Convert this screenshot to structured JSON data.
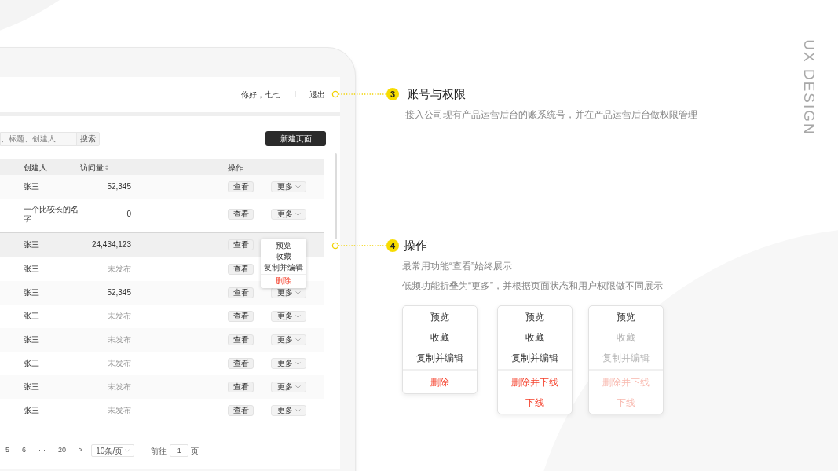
{
  "header": {
    "greeting": "你好，七七",
    "separator": "I",
    "logout": "退出"
  },
  "toolbar": {
    "search_placeholder": "、标题、创建人",
    "search_button": "搜索",
    "new_button": "新建页面"
  },
  "table": {
    "columns": [
      "创建人",
      "访问量",
      "操作"
    ],
    "rows": [
      {
        "creator": "张三",
        "visits": "52,345",
        "kind": "number",
        "view": "查看",
        "more": "更多",
        "selected": false
      },
      {
        "creator": "一个比较长的名字",
        "visits": "0",
        "kind": "number",
        "view": "查看",
        "more": "更多",
        "selected": false
      },
      {
        "creator": "张三",
        "visits": "24,434,123",
        "kind": "number",
        "view": "查看",
        "selected": true,
        "menu": [
          {
            "label": "预览",
            "kind": "normal"
          },
          {
            "label": "收藏",
            "kind": "normal"
          },
          {
            "label": "复制并编辑",
            "kind": "normal"
          },
          {
            "label": "删除",
            "kind": "danger"
          }
        ]
      },
      {
        "creator": "张三",
        "visits": "未发布",
        "kind": "status",
        "view": "查看",
        "selected": false
      },
      {
        "creator": "张三",
        "visits": "52,345",
        "kind": "number",
        "view": "查看",
        "more": "更多",
        "selected": false
      },
      {
        "creator": "张三",
        "visits": "未发布",
        "kind": "status",
        "view": "查看",
        "more": "更多",
        "selected": false
      },
      {
        "creator": "张三",
        "visits": "未发布",
        "kind": "status",
        "view": "查看",
        "more": "更多",
        "selected": false
      },
      {
        "creator": "张三",
        "visits": "未发布",
        "kind": "status",
        "view": "查看",
        "more": "更多",
        "selected": false
      },
      {
        "creator": "张三",
        "visits": "未发布",
        "kind": "status",
        "view": "查看",
        "more": "更多",
        "selected": false
      },
      {
        "creator": "张三",
        "visits": "未发布",
        "kind": "status",
        "view": "查看",
        "more": "更多",
        "selected": false
      }
    ]
  },
  "pagination": {
    "pages": [
      "5",
      "6",
      "···",
      "20"
    ],
    "next": ">",
    "page_size": "10条/页",
    "goto_label": "前往",
    "goto_value": "1",
    "goto_suffix": "页"
  },
  "annotations": [
    {
      "number": "3",
      "title": "账号与权限",
      "lines": [
        "接入公司现有产品运营后台的账系统号，并在产品运营后台做权限管理"
      ]
    },
    {
      "number": "4",
      "title": "操作",
      "lines": [
        "最常用功能“查看”始终展示",
        "低频功能折叠为“更多”，并根据页面状态和用户权限做不同展示"
      ]
    }
  ],
  "menus": [
    {
      "items": [
        {
          "label": "预览",
          "kind": "normal",
          "disabled": false
        },
        {
          "label": "收藏",
          "kind": "normal",
          "disabled": false
        },
        {
          "label": "复制并编辑",
          "kind": "normal",
          "disabled": false
        },
        {
          "label": "删除",
          "kind": "danger",
          "disabled": false
        }
      ]
    },
    {
      "items": [
        {
          "label": "预览",
          "kind": "normal",
          "disabled": false
        },
        {
          "label": "收藏",
          "kind": "normal",
          "disabled": false
        },
        {
          "label": "复制并编辑",
          "kind": "normal",
          "disabled": false
        },
        {
          "label": "删除并下线",
          "kind": "danger",
          "disabled": false
        },
        {
          "label": "下线",
          "kind": "danger",
          "disabled": false
        }
      ]
    },
    {
      "items": [
        {
          "label": "预览",
          "kind": "normal",
          "disabled": false
        },
        {
          "label": "收藏",
          "kind": "normal",
          "disabled": true
        },
        {
          "label": "复制并编辑",
          "kind": "normal",
          "disabled": true
        },
        {
          "label": "删除并下线",
          "kind": "danger",
          "disabled": true
        },
        {
          "label": "下线",
          "kind": "danger",
          "disabled": true
        }
      ]
    }
  ],
  "side_label": "UX DESIGN"
}
